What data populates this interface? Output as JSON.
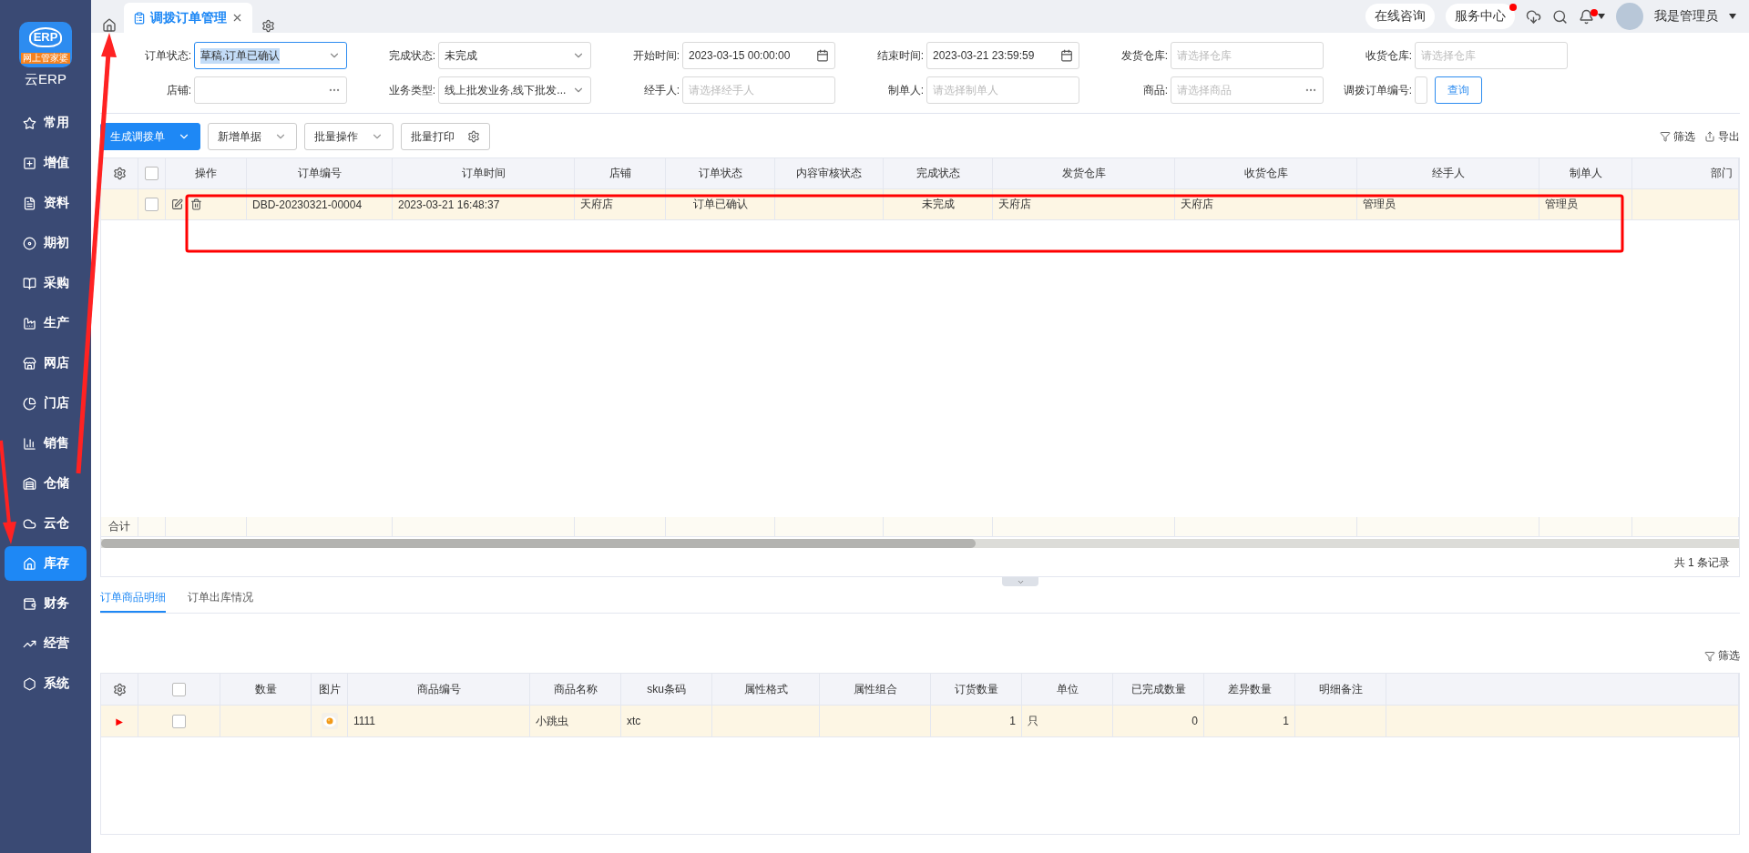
{
  "logo": {
    "mark": "ERP",
    "banner": "网上管家婆",
    "app_name": "云ERP"
  },
  "sidebar": {
    "items": [
      {
        "label": "常用",
        "selected": false
      },
      {
        "label": "增值",
        "selected": false
      },
      {
        "label": "资料",
        "selected": false
      },
      {
        "label": "期初",
        "selected": false
      },
      {
        "label": "采购",
        "selected": false
      },
      {
        "label": "生产",
        "selected": false
      },
      {
        "label": "网店",
        "selected": false
      },
      {
        "label": "门店",
        "selected": false
      },
      {
        "label": "销售",
        "selected": false
      },
      {
        "label": "仓储",
        "selected": false
      },
      {
        "label": "云仓",
        "selected": false
      },
      {
        "label": "库存",
        "selected": true
      },
      {
        "label": "财务",
        "selected": false
      },
      {
        "label": "经营",
        "selected": false
      },
      {
        "label": "系统",
        "selected": false
      }
    ]
  },
  "tabs": [
    {
      "label": "调拨订单管理",
      "selected": true
    }
  ],
  "header": {
    "links": [
      {
        "label": "在线咨询",
        "dot": false
      },
      {
        "label": "服务中心",
        "dot": true
      }
    ],
    "bell_dot": true,
    "user": "我是管理员"
  },
  "filters": [
    {
      "label": "订单状态:",
      "kind": "select",
      "value": "草稿,订单已确认",
      "highlighted": true
    },
    {
      "label": "完成状态:",
      "kind": "select",
      "value": "未完成"
    },
    {
      "label": "开始时间:",
      "kind": "date",
      "value": "2023-03-15 00:00:00"
    },
    {
      "label": "结束时间:",
      "kind": "date",
      "value": "2023-03-21 23:59:59"
    },
    {
      "label": "发货仓库:",
      "kind": "input",
      "placeholder": "请选择仓库"
    },
    {
      "label": "收货仓库:",
      "kind": "input",
      "placeholder": "请选择仓库"
    },
    {
      "label": "店铺:",
      "kind": "picker"
    },
    {
      "label": "业务类型:",
      "kind": "select",
      "value": "线上批发业务,线下批发..."
    },
    {
      "label": "经手人:",
      "kind": "input",
      "placeholder": "请选择经手人"
    },
    {
      "label": "制单人:",
      "kind": "input",
      "placeholder": "请选择制单人"
    },
    {
      "label": "商品:",
      "kind": "picker",
      "placeholder": "请选择商品"
    },
    {
      "label": "调拨订单编号:",
      "kind": "input"
    }
  ],
  "query_button": "查询",
  "toolbar": {
    "buttons": [
      {
        "label": "生成调拨单",
        "kind": "primary"
      },
      {
        "label": "新增单据",
        "kind": "dropdown"
      },
      {
        "label": "批量操作",
        "kind": "dropdown"
      },
      {
        "label": "批量打印",
        "kind": "settings"
      }
    ],
    "filter": "筛选",
    "export": "导出"
  },
  "orders_table": {
    "all_checked": false,
    "columns": [
      "操作",
      "订单编号",
      "订单时间",
      "店铺",
      "订单状态",
      "内容审核状态",
      "完成状态",
      "发货仓库",
      "收货仓库",
      "经手人",
      "制单人",
      "部门"
    ],
    "rows": [
      {
        "selected": true,
        "checked": false,
        "cells": [
          "",
          "DBD-20230321-00004",
          "2023-03-21 16:48:37",
          "天府店",
          "订单已确认",
          "",
          "未完成",
          "天府店",
          "天府店",
          "管理员",
          "管理员",
          ""
        ]
      }
    ],
    "total_label": "合计",
    "record_count": "共 1 条记录"
  },
  "detail_tabs": [
    {
      "label": "订单商品明细",
      "selected": true
    },
    {
      "label": "订单出库情况",
      "selected": false
    }
  ],
  "detail_filter": "筛选",
  "detail_table": {
    "all_checked": false,
    "columns": [
      "数量",
      "图片",
      "商品编号",
      "商品名称",
      "sku条码",
      "属性格式",
      "属性组合",
      "订货数量",
      "单位",
      "已完成数量",
      "差异数量",
      "明细备注"
    ],
    "rows": [
      {
        "marker": "▶",
        "checked": false,
        "cells": [
          "",
          "",
          "1111",
          "小跳虫",
          "xtc",
          "",
          "",
          "1",
          "只",
          "0",
          "1",
          ""
        ]
      }
    ]
  }
}
